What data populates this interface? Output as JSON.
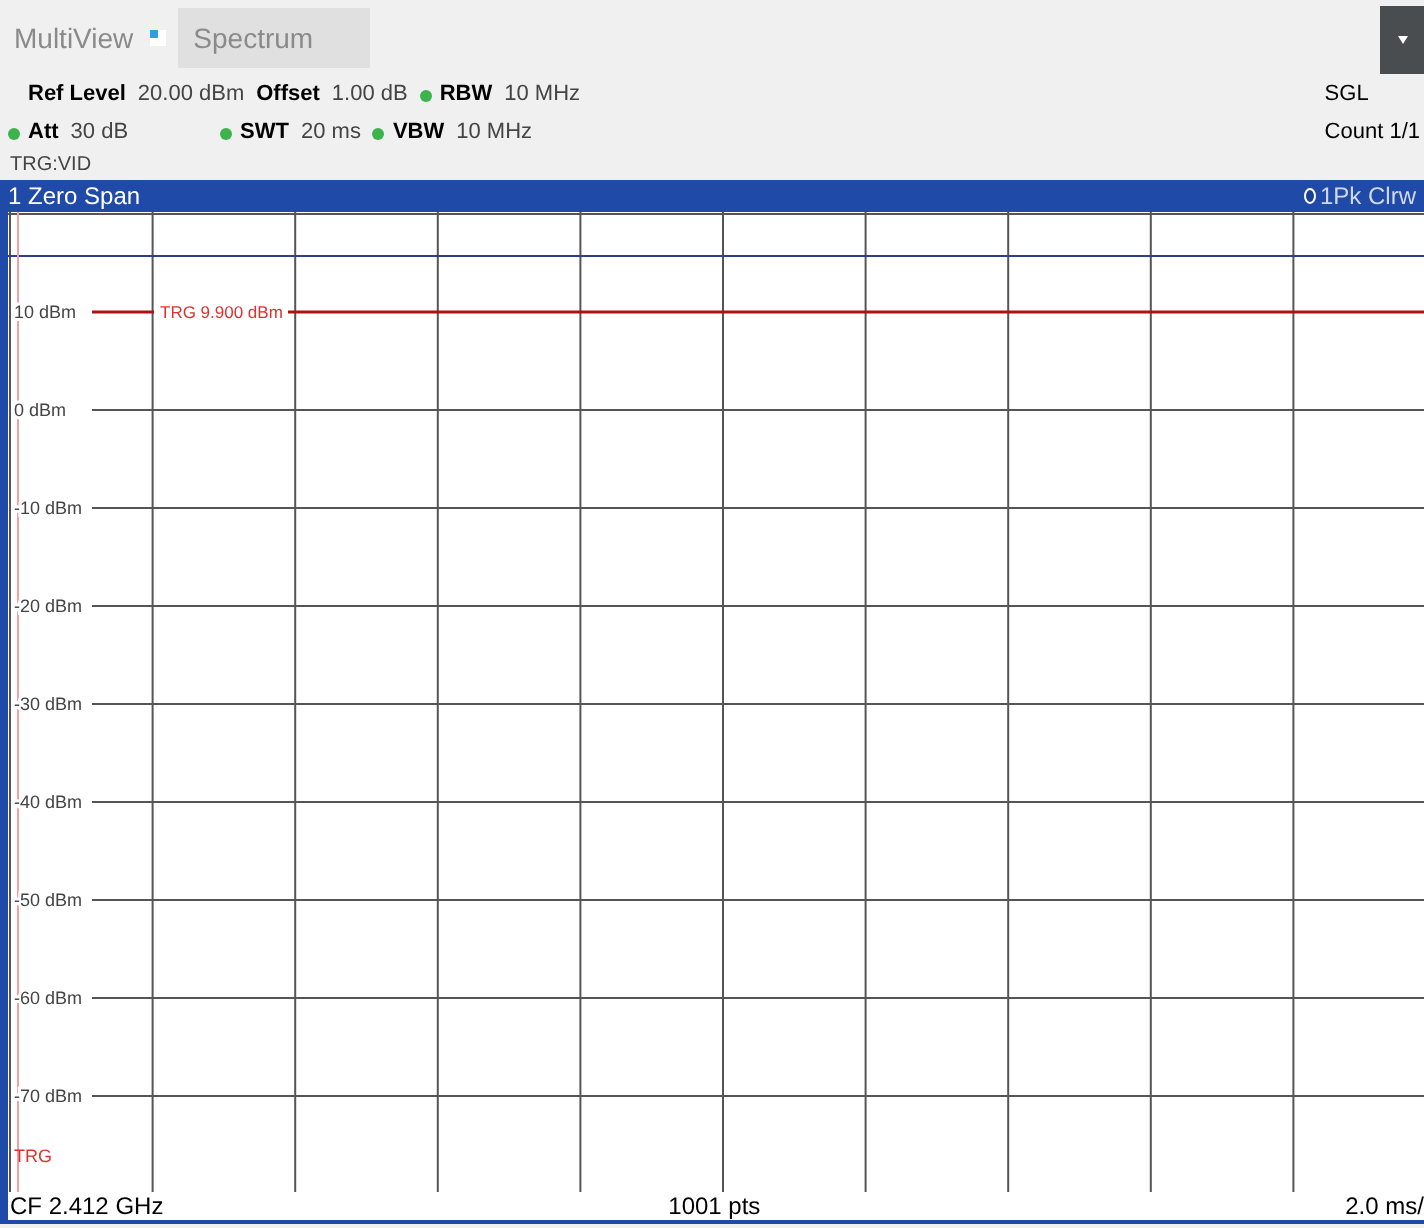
{
  "toolbar": {
    "title": "MultiView",
    "tabs": [
      {
        "label": "Spectrum",
        "selected": true
      }
    ]
  },
  "settings": {
    "row_1": [
      {
        "label": "Ref Level",
        "value": "20.00 dBm",
        "dot": false
      },
      {
        "label": "Offset",
        "value": "1.00 dB",
        "dot": false
      },
      {
        "label": "RBW",
        "value": "10 MHz",
        "dot": true
      }
    ],
    "row_2": [
      {
        "label": "Att",
        "value": "30 dB",
        "dot": true
      },
      {
        "label": "SWT",
        "value": "20 ms",
        "dot": true
      },
      {
        "label": "VBW",
        "value": "10 MHz",
        "dot": true
      }
    ],
    "trigger": "TRG:VID",
    "mode": "SGL",
    "count": "Count 1/1"
  },
  "window": {
    "title": "1 Zero Span",
    "trace": "1Pk Clrw"
  },
  "plot": {
    "y_labels": [
      "10 dBm",
      "0 dBm",
      "-10 dBm",
      "-20 dBm",
      "-30 dBm",
      "-40 dBm",
      "-50 dBm",
      "-60 dBm",
      "-70 dBm"
    ],
    "trigger_label": "TRG  9.900 dBm",
    "trigger_mark": "TRG"
  },
  "footer": {
    "center_frequency": "CF 2.412 GHz",
    "points": "1001 pts",
    "scale": "2.0 ms/"
  }
}
